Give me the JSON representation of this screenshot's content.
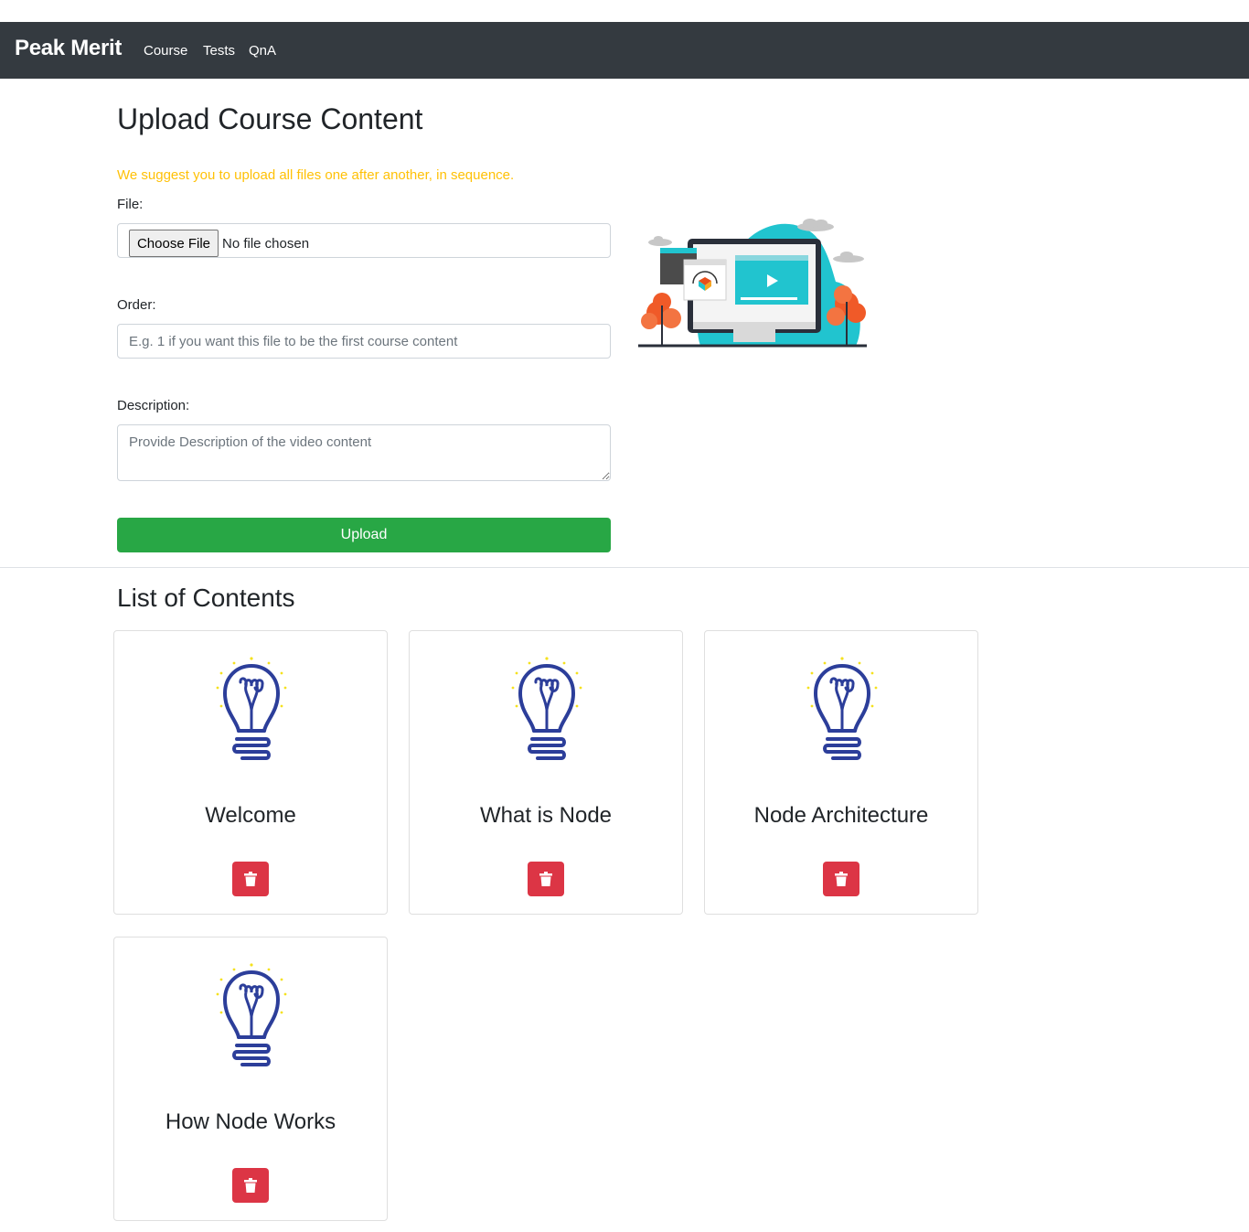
{
  "nav": {
    "brand": "Peak Merit",
    "links": [
      "Course",
      "Tests",
      "QnA"
    ]
  },
  "upload": {
    "title": "Upload Course Content",
    "suggestion": "We suggest you to upload all files one after another, in sequence.",
    "file_label": "File:",
    "choose_file": "Choose File",
    "no_file": "No file chosen",
    "order_label": "Order:",
    "order_placeholder": "E.g. 1 if you want this file to be the first course content",
    "description_label": "Description:",
    "description_placeholder": "Provide Description of the video content",
    "upload_button": "Upload"
  },
  "contents": {
    "title": "List of Contents",
    "items": [
      {
        "title": "Welcome"
      },
      {
        "title": "What is Node"
      },
      {
        "title": "Node Architecture"
      },
      {
        "title": "How Node Works"
      }
    ]
  },
  "colors": {
    "navbar": "#343a40",
    "warning": "#ffc107",
    "success": "#28a745",
    "danger": "#dc3545",
    "bulb": "#2c3e9a"
  },
  "icons": {
    "card_icon": "lightbulb-icon",
    "delete_icon": "trash-icon"
  }
}
